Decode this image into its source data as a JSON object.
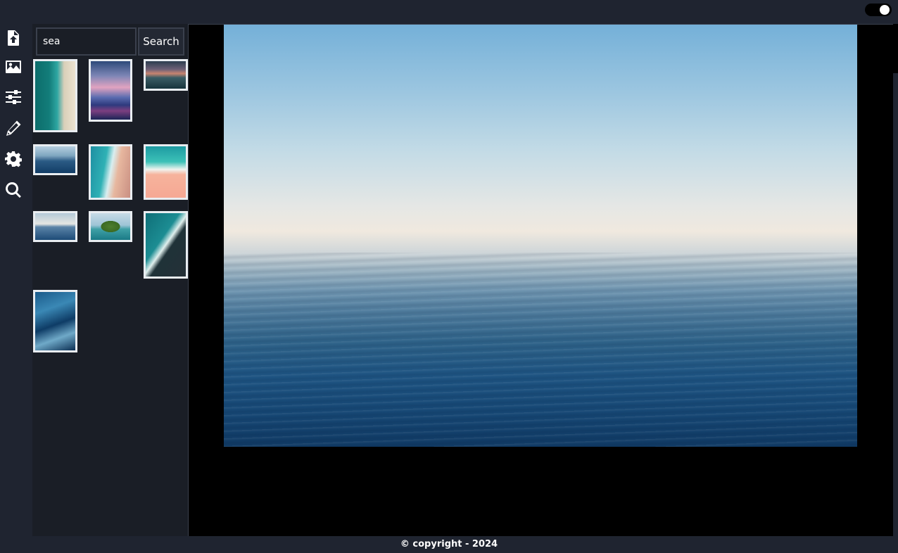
{
  "header": {
    "theme_toggle": {
      "state": "on"
    }
  },
  "toolbar": {
    "items": [
      {
        "name": "upload",
        "icon": "file-upload-icon"
      },
      {
        "name": "image",
        "icon": "image-icon"
      },
      {
        "name": "adjust",
        "icon": "sliders-icon"
      },
      {
        "name": "edit",
        "icon": "pencil-icon"
      },
      {
        "name": "settings",
        "icon": "gear-icon"
      },
      {
        "name": "search",
        "icon": "magnifier-icon"
      }
    ]
  },
  "search": {
    "value": "sea",
    "button_label": "Search"
  },
  "results": {
    "thumbnails": [
      {
        "subject": "aerial beach shoreline"
      },
      {
        "subject": "sunset sea reflection"
      },
      {
        "subject": "sunset over waves"
      },
      {
        "subject": "calm sea horizon"
      },
      {
        "subject": "aerial waves on sand"
      },
      {
        "subject": "turquoise sea and pink sand"
      },
      {
        "subject": "sea horizon at dusk"
      },
      {
        "subject": "small green island"
      },
      {
        "subject": "aerial rocky coast"
      },
      {
        "subject": "blue water surface"
      }
    ]
  },
  "viewer": {
    "image_subject": "open sea under clear sky"
  },
  "footer": {
    "text": "© copyright - 2024"
  },
  "colors": {
    "background": "#1f2430",
    "panel": "#1a1e26",
    "viewer": "#000000",
    "thumb_border": "#e9edf1",
    "text": "#ffffff"
  }
}
